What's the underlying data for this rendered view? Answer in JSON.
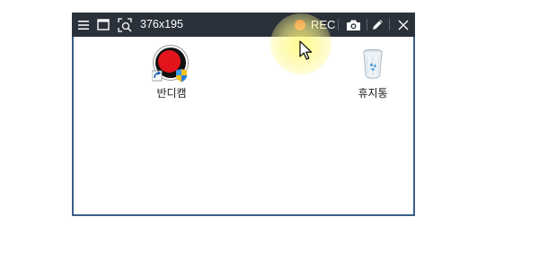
{
  "toolbar": {
    "size_label": "376x195",
    "rec_label": "REC",
    "icons": [
      "menu-icon",
      "window-icon",
      "area-zoom-icon",
      "camera-icon",
      "pencil-icon",
      "close-icon"
    ],
    "rec_color": "#e8571f",
    "background": "#2b313b"
  },
  "desktop": {
    "icons": [
      {
        "label": "반디캠",
        "icon": "bandicam-app-icon"
      },
      {
        "label": "휴지통",
        "icon": "recycle-bin-icon"
      }
    ]
  },
  "colors": {
    "frame_border": "#3a5f86"
  }
}
